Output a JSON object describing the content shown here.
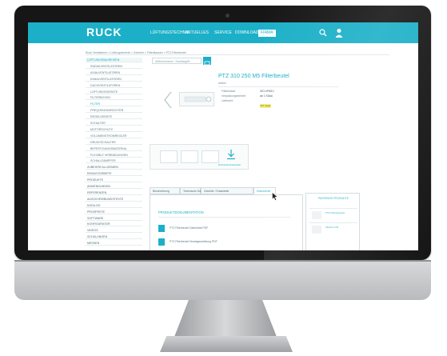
{
  "site": {
    "logo": "RUCK",
    "nav": [
      {
        "label": "LÜFTUNGSTECHNIK"
      },
      {
        "label": "AKTUELLES"
      },
      {
        "label": "SERVICE"
      },
      {
        "label": "DOWNLOADS"
      },
      {
        "label": "FIRMA"
      }
    ],
    "active_nav_index": 4
  },
  "breadcrumb": "Ruck Ventilatoren > Lüftungstechnik > Zubehör > Filterklassen > PTZ-Filterbeutel",
  "sidebar": {
    "items": [
      {
        "label": "LÜFTUNGSBAUREIHEN",
        "type": "head"
      },
      {
        "label": "RADIALVENTILATOREN",
        "type": "sub"
      },
      {
        "label": "AXIALVENTILATOREN",
        "type": "sub"
      },
      {
        "label": "KANALVENTILATOREN",
        "type": "sub"
      },
      {
        "label": "DACHVENTILATOREN",
        "type": "sub"
      },
      {
        "label": "LÜFTUNGSGERÄTE",
        "type": "sub"
      },
      {
        "label": "FILTERBOXEN",
        "type": "sub"
      },
      {
        "label": "FILTER",
        "type": "active"
      },
      {
        "label": "FREQUENZUMRICHTER",
        "type": "sub"
      },
      {
        "label": "REGELGERÄTE",
        "type": "sub"
      },
      {
        "label": "SCHALTER",
        "type": "sub"
      },
      {
        "label": "MOTORSCHUTZ",
        "type": "sub"
      },
      {
        "label": "VOLUMENSTROMREGLER",
        "type": "sub"
      },
      {
        "label": "DRUCKSCHALTER",
        "type": "sub"
      },
      {
        "label": "BEFESTIGUNGSMATERIAL",
        "type": "sub"
      },
      {
        "label": "FLEXIBLE VERBINDUNGEN",
        "type": "sub"
      },
      {
        "label": "SCHALLDÄMPFER",
        "type": "sub"
      },
      {
        "label": "ZUBEHÖR ALLGEMEIN",
        "type": "normal"
      },
      {
        "label": "EINSATZGEBIETE",
        "type": "normal"
      },
      {
        "label": "PRODUKTE",
        "type": "normal"
      },
      {
        "label": "ANWENDUNGEN",
        "type": "normal"
      },
      {
        "label": "REFERENZEN",
        "type": "normal"
      },
      {
        "label": "AUSSCHREIBUNGSTEXTE",
        "type": "normal"
      },
      {
        "label": "KATALOG",
        "type": "normal"
      },
      {
        "label": "PROSPEKTE",
        "type": "normal"
      },
      {
        "label": "SOFTWARE",
        "type": "normal"
      },
      {
        "label": "KONFIGURATOR",
        "type": "normal"
      },
      {
        "label": "VIDEOS",
        "type": "normal"
      },
      {
        "label": "SCHULUNGEN",
        "type": "normal"
      },
      {
        "label": "MESSEN",
        "type": "normal"
      }
    ]
  },
  "search": {
    "placeholder": "Artikelnummer / Suchbegriff"
  },
  "product": {
    "title": "PTZ 310 250 M5 Filterbeutel",
    "subtitle": "Artikel",
    "specs": [
      {
        "label": "Filterklasse:",
        "value": "ISO ePM10"
      },
      {
        "label": "Verpackungseinheit:",
        "value": "ab 1 Stück"
      },
      {
        "label": "Lieferzeit:",
        "value": ""
      }
    ],
    "stock": "Auf Lager"
  },
  "thumbs": [
    "",
    "",
    ""
  ],
  "download_label": "Download Datenblatt",
  "tabs": [
    {
      "label": "Beschreibung"
    },
    {
      "label": "Technische Daten"
    },
    {
      "label": "Zubehör / Ersatzteile"
    },
    {
      "label": "Dokumente"
    }
  ],
  "active_tab_index": 3,
  "panel": {
    "heading": "PRODUKTDOKUMENTATION",
    "docs": [
      {
        "text": "PTZ Filterbeutel Datenblatt PDF"
      },
      {
        "text": "PTZ Filterbeutel Montageanleitung PDF"
      }
    ]
  },
  "related": {
    "title": "PASSENDE PRODUKTE",
    "items": [
      {
        "text": "PTZ Filterkassette"
      },
      {
        "text": "Filterbox FB"
      }
    ]
  },
  "colors": {
    "accent": "#1cb0c8"
  }
}
